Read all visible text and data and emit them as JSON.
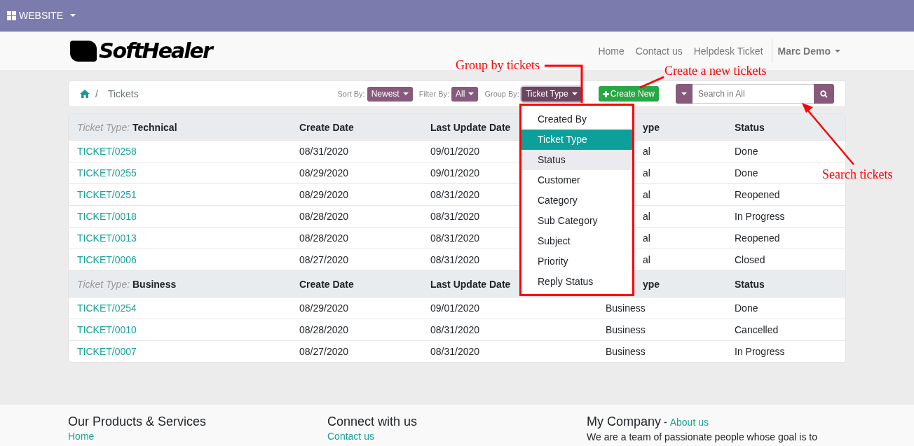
{
  "top_bar": {
    "menu_label": "WEBSITE"
  },
  "header": {
    "logo_text": "SoftHealer",
    "nav": [
      {
        "label": "Home"
      },
      {
        "label": "Contact us"
      },
      {
        "label": "Helpdesk Ticket"
      }
    ],
    "user": "Marc Demo"
  },
  "breadcrumb": {
    "separator": "/",
    "current": "Tickets"
  },
  "toolbar": {
    "sort": {
      "label": "Sort By:",
      "value": "Newest"
    },
    "filter": {
      "label": "Filter By:",
      "value": "All"
    },
    "group": {
      "label": "Group By:",
      "value": "Ticket Type",
      "open": true
    },
    "create_button": "Create New",
    "search": {
      "placeholder": "Search in All"
    }
  },
  "group_menu": [
    {
      "label": "Created By",
      "selected": false,
      "hover": false
    },
    {
      "label": "Ticket Type",
      "selected": true,
      "hover": false
    },
    {
      "label": "Status",
      "selected": false,
      "hover": true
    },
    {
      "label": "Customer",
      "selected": false,
      "hover": false
    },
    {
      "label": "Category",
      "selected": false,
      "hover": false
    },
    {
      "label": "Sub Category",
      "selected": false,
      "hover": false
    },
    {
      "label": "Subject",
      "selected": false,
      "hover": false
    },
    {
      "label": "Priority",
      "selected": false,
      "hover": false
    },
    {
      "label": "Reply Status",
      "selected": false,
      "hover": false
    }
  ],
  "table": {
    "groups": [
      {
        "prefix": "Ticket Type:",
        "name": "Technical",
        "columns": [
          "Create Date",
          "Last Update Date",
          {
            "visible_tail": "ype"
          },
          "Status"
        ],
        "rows": [
          {
            "ticket": "TICKET/0258",
            "cells": [
              "08/31/2020",
              "09/01/2020",
              {
                "visible_tail": "al"
              },
              "Done"
            ]
          },
          {
            "ticket": "TICKET/0255",
            "cells": [
              "08/29/2020",
              "09/01/2020",
              {
                "visible_tail": "al"
              },
              "Done"
            ]
          },
          {
            "ticket": "TICKET/0251",
            "cells": [
              "08/29/2020",
              "08/31/2020",
              {
                "visible_tail": "al"
              },
              "Reopened"
            ]
          },
          {
            "ticket": "TICKET/0018",
            "cells": [
              "08/28/2020",
              "08/31/2020",
              {
                "visible_tail": "al"
              },
              "In Progress"
            ]
          },
          {
            "ticket": "TICKET/0013",
            "cells": [
              "08/28/2020",
              "08/31/2020",
              {
                "visible_tail": "al"
              },
              "Reopened"
            ]
          },
          {
            "ticket": "TICKET/0006",
            "cells": [
              "08/27/2020",
              "08/31/2020",
              {
                "visible_tail": "al"
              },
              "Closed"
            ]
          }
        ]
      },
      {
        "prefix": "Ticket Type:",
        "name": "Business",
        "columns": [
          "Create Date",
          "Last Update Date",
          {
            "visible_tail": "ype"
          },
          "Status"
        ],
        "rows": [
          {
            "ticket": "TICKET/0254",
            "cells": [
              "08/29/2020",
              "09/01/2020",
              "Business",
              "Done"
            ]
          },
          {
            "ticket": "TICKET/0010",
            "cells": [
              "08/28/2020",
              "08/31/2020",
              "Business",
              "Cancelled"
            ]
          },
          {
            "ticket": "TICKET/0007",
            "cells": [
              "08/27/2020",
              "08/31/2020",
              "Business",
              "In Progress"
            ]
          }
        ]
      }
    ]
  },
  "annotations": [
    {
      "kind": "group",
      "text": "Group by tickets"
    },
    {
      "kind": "create",
      "text": "Create a new tickets"
    },
    {
      "kind": "search",
      "text": "Search tickets"
    }
  ],
  "footer": [
    {
      "title": "Our Products & Services",
      "link": "Home"
    },
    {
      "title": "Connect with us",
      "link": "Contact us"
    },
    {
      "title": "My Company",
      "separator": "-",
      "title_link": "About us",
      "text": "We are a team of passionate people whose goal is to"
    }
  ]
}
